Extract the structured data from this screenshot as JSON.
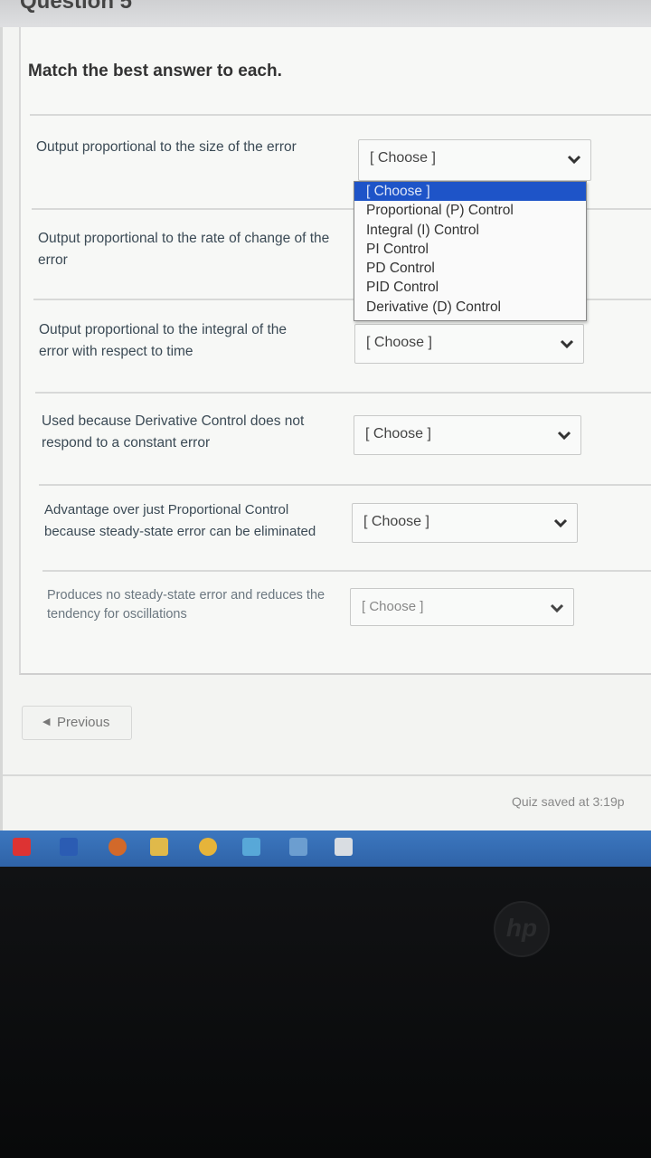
{
  "header": {
    "question_title": "Question 5"
  },
  "prompt": "Match the best answer to each.",
  "questions": [
    {
      "label": "Output proportional to the size of the error",
      "selected": "[ Choose ]"
    },
    {
      "label": "Output proportional to the rate of change of the error",
      "selected": "[ Choose ]"
    },
    {
      "label": "Output proportional to the integral of the error with respect to time",
      "selected": "[ Choose ]"
    },
    {
      "label": "Used because Derivative Control does not respond to a constant error",
      "selected": "[ Choose ]"
    },
    {
      "label": "Advantage over just Proportional Control because steady-state error can be eliminated",
      "selected": "[ Choose ]"
    },
    {
      "label": "Produces no steady-state error and reduces the tendency for oscillations",
      "selected": "[ Choose ]"
    }
  ],
  "dropdown": {
    "options": [
      "[ Choose ]",
      "Proportional (P) Control",
      "Integral (I) Control",
      "PI Control",
      "PD Control",
      "PID Control",
      "Derivative (D) Control"
    ],
    "highlighted_index": 0
  },
  "nav": {
    "previous_label": "Previous"
  },
  "status": {
    "saved_text": "Quiz saved at 3:19p"
  },
  "colors": {
    "accent": "#1e54c8",
    "taskbar": "#3c77bf"
  },
  "taskbar_icons": [
    "adobe-icon",
    "word-icon",
    "app-icon",
    "explorer-icon",
    "chrome-icon",
    "edge-icon",
    "store-icon",
    "app-icon"
  ]
}
